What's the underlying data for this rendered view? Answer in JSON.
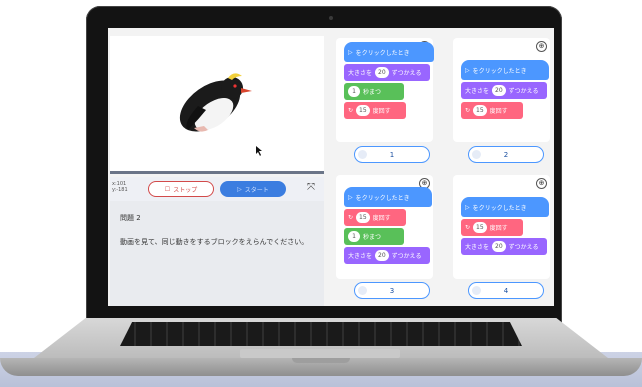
{
  "stage": {
    "coords": [
      "x:101",
      "y:-181"
    ],
    "stop_label": "ストップ",
    "start_label": "スタート"
  },
  "question": {
    "title": "問題 2",
    "text": "動画を見て、同じ動きをするブロックをえらんでください。"
  },
  "choices": [
    {
      "number": "1",
      "blocks": [
        {
          "type": "hat",
          "text": "をクリックしたとき"
        },
        {
          "type": "purple",
          "pre": "大きさを",
          "val": "20",
          "post": "ずつかえる"
        },
        {
          "type": "green",
          "pre": "",
          "val": "1",
          "post": "秒まつ"
        },
        {
          "type": "pink",
          "pre": "",
          "val": "15",
          "post": "度回す"
        }
      ]
    },
    {
      "number": "2",
      "blocks": [
        {
          "type": "hat",
          "text": "をクリックしたとき"
        },
        {
          "type": "purple",
          "pre": "大きさを",
          "val": "20",
          "post": "ずつかえる"
        },
        {
          "type": "pink",
          "pre": "",
          "val": "15",
          "post": "度回す"
        }
      ]
    },
    {
      "number": "3",
      "blocks": [
        {
          "type": "hat",
          "text": "をクリックしたとき"
        },
        {
          "type": "pink",
          "pre": "",
          "val": "15",
          "post": "度回す"
        },
        {
          "type": "green",
          "pre": "",
          "val": "1",
          "post": "秒まつ"
        },
        {
          "type": "purple",
          "pre": "大きさを",
          "val": "20",
          "post": "ずつかえる"
        }
      ]
    },
    {
      "number": "4",
      "blocks": [
        {
          "type": "hat",
          "text": "をクリックしたとき"
        },
        {
          "type": "pink",
          "pre": "",
          "val": "15",
          "post": "度回す"
        },
        {
          "type": "purple",
          "pre": "大きさを",
          "val": "20",
          "post": "ずつかえる"
        }
      ]
    }
  ],
  "colors": {
    "hat": "#4c97ff",
    "looks": "#9966ff",
    "control": "#59c059",
    "motion": "#ff6680"
  }
}
